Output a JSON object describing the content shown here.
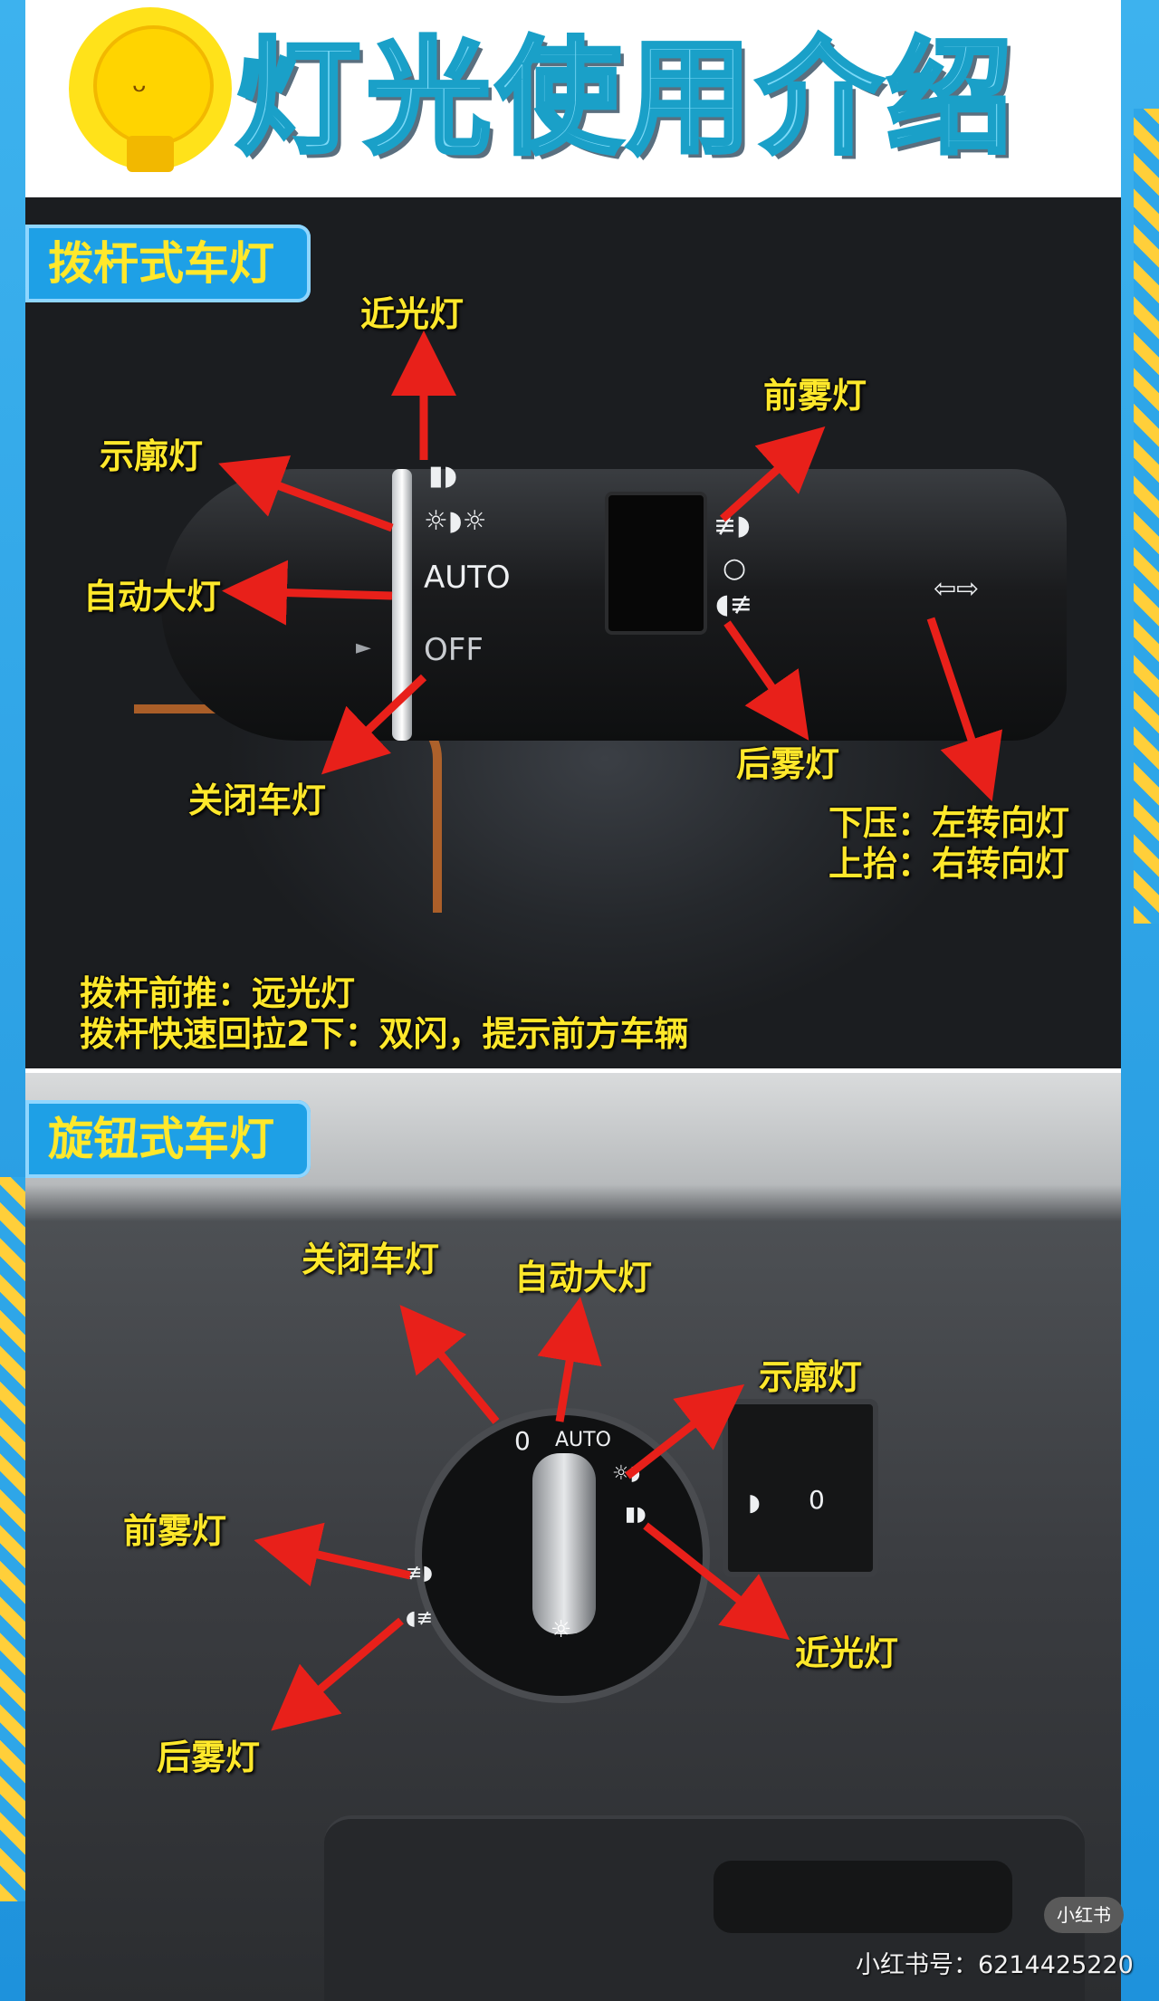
{
  "page": {
    "title": "灯光使用介绍"
  },
  "stalk_section": {
    "tag": "拨杆式车灯",
    "switch_text": {
      "auto": "AUTO",
      "off": "OFF"
    },
    "labels": {
      "low_beam": "近光灯",
      "position_lamp": "示廓灯",
      "auto_headlight": "自动大灯",
      "lights_off": "关闭车灯",
      "front_fog": "前雾灯",
      "rear_fog": "后雾灯",
      "turn_down": "下压：左转向灯",
      "turn_up": "上抬：右转向灯",
      "push_forward": "拨杆前推：远光灯",
      "pull_back": "拨杆快速回拉2下：双闪，提示前方车辆"
    }
  },
  "knob_section": {
    "tag": "旋钮式车灯",
    "dial_text": {
      "off": "0",
      "auto": "AUTO",
      "sub_off": "0"
    },
    "labels": {
      "lights_off": "关闭车灯",
      "auto_headlight": "自动大灯",
      "position_lamp": "示廓灯",
      "front_fog": "前雾灯",
      "low_beam": "近光灯",
      "rear_fog": "后雾灯"
    }
  },
  "watermark": {
    "badge": "小红书",
    "id_text": "小红书号：6214425220"
  },
  "colors": {
    "accent_blue": "#1ea0e6",
    "label_yellow": "#ffe82b",
    "arrow_red": "#e8201a"
  }
}
